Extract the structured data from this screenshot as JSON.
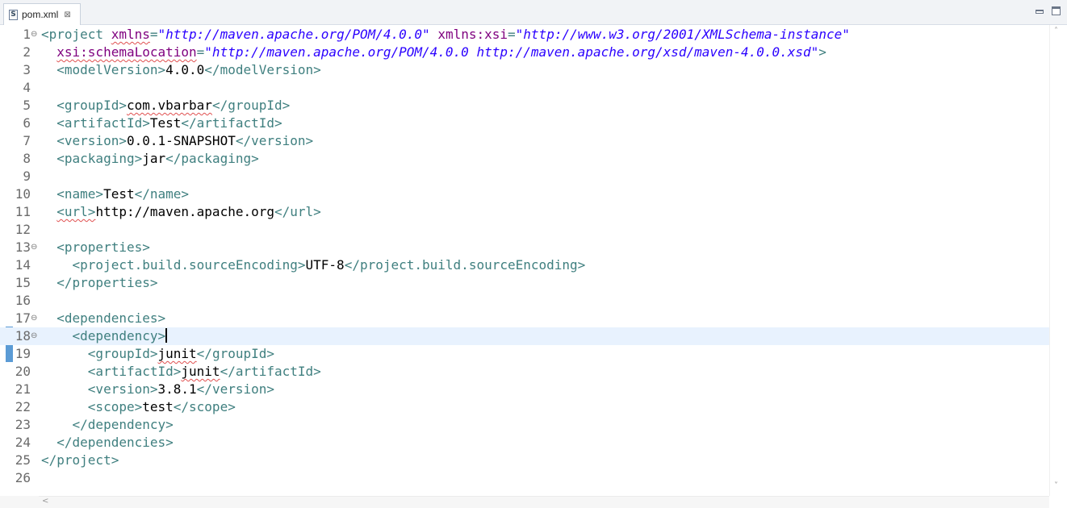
{
  "tab": {
    "title": "pom.xml",
    "icon": "xml-file-icon",
    "close_glyph": "⊠",
    "file_glyph": "S"
  },
  "editor": {
    "lines": [
      {
        "n": "1",
        "fold": true,
        "parts": [
          [
            "tag",
            "<project "
          ],
          [
            "attr",
            "xmlns"
          ],
          [
            "tag",
            "="
          ],
          [
            "val",
            "\"http://maven.apache.org/POM/4.0.0\""
          ],
          [
            "text",
            " "
          ],
          [
            "attr",
            "xmlns:xsi"
          ],
          [
            "tag",
            "="
          ],
          [
            "val",
            "\"http://www.w3.org/2001/XMLSchema-instance\""
          ]
        ]
      },
      {
        "n": "2",
        "parts": [
          [
            "text",
            "  "
          ],
          [
            "attr",
            "xsi:schemaLocation"
          ],
          [
            "tag",
            "="
          ],
          [
            "val",
            "\"http://maven.apache.org/POM/4.0.0 http://maven.apache.org/xsd/maven-4.0.0.xsd\""
          ],
          [
            "tag",
            ">"
          ]
        ]
      },
      {
        "n": "3",
        "parts": [
          [
            "text",
            "  "
          ],
          [
            "tag",
            "<modelVersion>"
          ],
          [
            "text",
            "4.0.0"
          ],
          [
            "tag",
            "</modelVersion>"
          ]
        ]
      },
      {
        "n": "4",
        "parts": []
      },
      {
        "n": "5",
        "parts": [
          [
            "text",
            "  "
          ],
          [
            "tag",
            "<groupId>"
          ],
          [
            "text",
            "com.vbarbar"
          ],
          [
            "tag",
            "</groupId>"
          ]
        ]
      },
      {
        "n": "6",
        "parts": [
          [
            "text",
            "  "
          ],
          [
            "tag",
            "<artifactId>"
          ],
          [
            "text",
            "Test"
          ],
          [
            "tag",
            "</artifactId>"
          ]
        ]
      },
      {
        "n": "7",
        "parts": [
          [
            "text",
            "  "
          ],
          [
            "tag",
            "<version>"
          ],
          [
            "text",
            "0.0.1-SNAPSHOT"
          ],
          [
            "tag",
            "</version>"
          ]
        ]
      },
      {
        "n": "8",
        "parts": [
          [
            "text",
            "  "
          ],
          [
            "tag",
            "<packaging>"
          ],
          [
            "text",
            "jar"
          ],
          [
            "tag",
            "</packaging>"
          ]
        ]
      },
      {
        "n": "9",
        "parts": []
      },
      {
        "n": "10",
        "parts": [
          [
            "text",
            "  "
          ],
          [
            "tag",
            "<name>"
          ],
          [
            "text",
            "Test"
          ],
          [
            "tag",
            "</name>"
          ]
        ]
      },
      {
        "n": "11",
        "parts": [
          [
            "text",
            "  "
          ],
          [
            "tag",
            "<url>"
          ],
          [
            "text",
            "http://maven.apache.org"
          ],
          [
            "tag",
            "</url>"
          ]
        ]
      },
      {
        "n": "12",
        "parts": []
      },
      {
        "n": "13",
        "fold": true,
        "parts": [
          [
            "text",
            "  "
          ],
          [
            "tag",
            "<properties>"
          ]
        ]
      },
      {
        "n": "14",
        "parts": [
          [
            "text",
            "    "
          ],
          [
            "tag",
            "<project.build.sourceEncoding>"
          ],
          [
            "text",
            "UTF-8"
          ],
          [
            "tag",
            "</project.build.sourceEncoding>"
          ]
        ]
      },
      {
        "n": "15",
        "parts": [
          [
            "text",
            "  "
          ],
          [
            "tag",
            "</properties>"
          ]
        ]
      },
      {
        "n": "16",
        "parts": []
      },
      {
        "n": "17",
        "fold": true,
        "parts": [
          [
            "text",
            "  "
          ],
          [
            "tag",
            "<dependencies>"
          ]
        ]
      },
      {
        "n": "18",
        "fold": true,
        "current": true,
        "parts": [
          [
            "text",
            "    "
          ],
          [
            "tag",
            "<dependency>"
          ]
        ]
      },
      {
        "n": "19",
        "parts": [
          [
            "text",
            "      "
          ],
          [
            "tag",
            "<groupId>"
          ],
          [
            "text",
            "junit"
          ],
          [
            "tag",
            "</groupId>"
          ]
        ]
      },
      {
        "n": "20",
        "parts": [
          [
            "text",
            "      "
          ],
          [
            "tag",
            "<artifactId>"
          ],
          [
            "text",
            "junit"
          ],
          [
            "tag",
            "</artifactId>"
          ]
        ]
      },
      {
        "n": "21",
        "parts": [
          [
            "text",
            "      "
          ],
          [
            "tag",
            "<version>"
          ],
          [
            "text",
            "3.8.1"
          ],
          [
            "tag",
            "</version>"
          ]
        ]
      },
      {
        "n": "22",
        "parts": [
          [
            "text",
            "      "
          ],
          [
            "tag",
            "<scope>"
          ],
          [
            "text",
            "test"
          ],
          [
            "tag",
            "</scope>"
          ]
        ]
      },
      {
        "n": "23",
        "parts": [
          [
            "text",
            "    "
          ],
          [
            "tag",
            "</dependency>"
          ]
        ]
      },
      {
        "n": "24",
        "parts": [
          [
            "text",
            "  "
          ],
          [
            "tag",
            "</dependencies>"
          ]
        ]
      },
      {
        "n": "25",
        "parts": [
          [
            "tag",
            "</project>"
          ]
        ]
      },
      {
        "n": "26",
        "parts": []
      }
    ]
  },
  "fold_glyph": "⊖",
  "scroll": {
    "up": "˄",
    "down": "˅",
    "left": "<"
  }
}
